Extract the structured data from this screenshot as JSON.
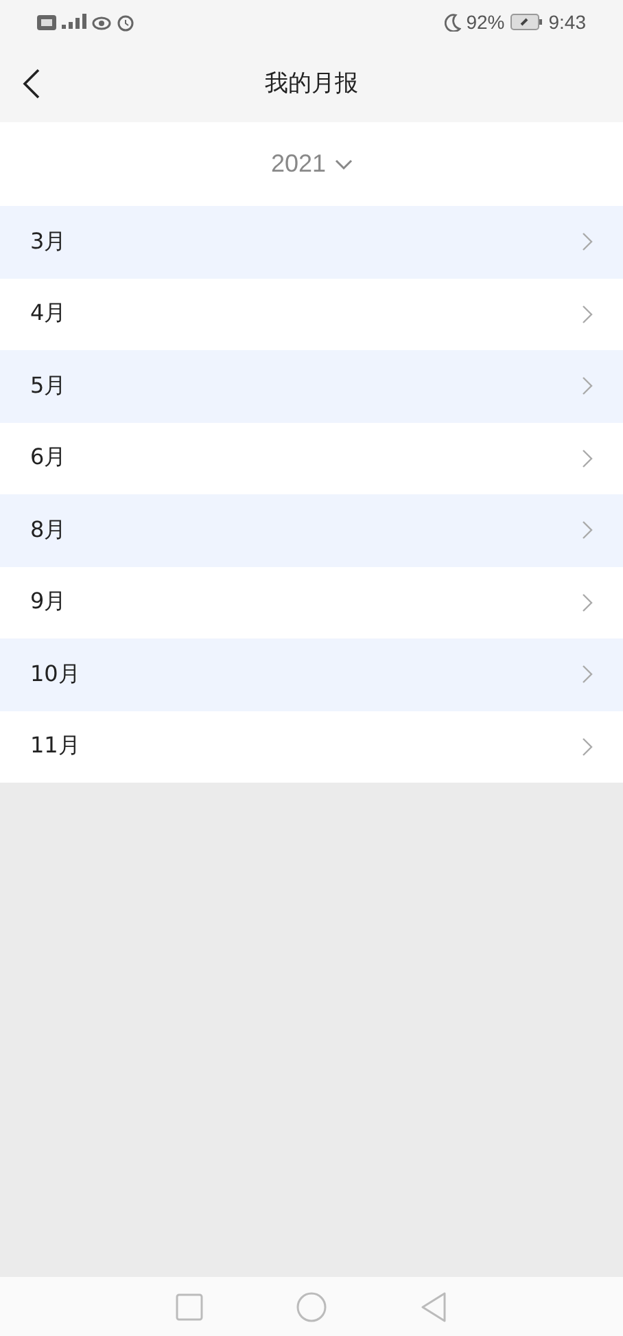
{
  "status_bar": {
    "battery": "92%",
    "time": "9:43"
  },
  "header": {
    "title": "我的月报"
  },
  "year_picker": {
    "value": "2021"
  },
  "months": [
    {
      "label": "3月"
    },
    {
      "label": "4月"
    },
    {
      "label": "5月"
    },
    {
      "label": "6月"
    },
    {
      "label": "8月"
    },
    {
      "label": "9月"
    },
    {
      "label": "10月"
    },
    {
      "label": "11月"
    }
  ]
}
